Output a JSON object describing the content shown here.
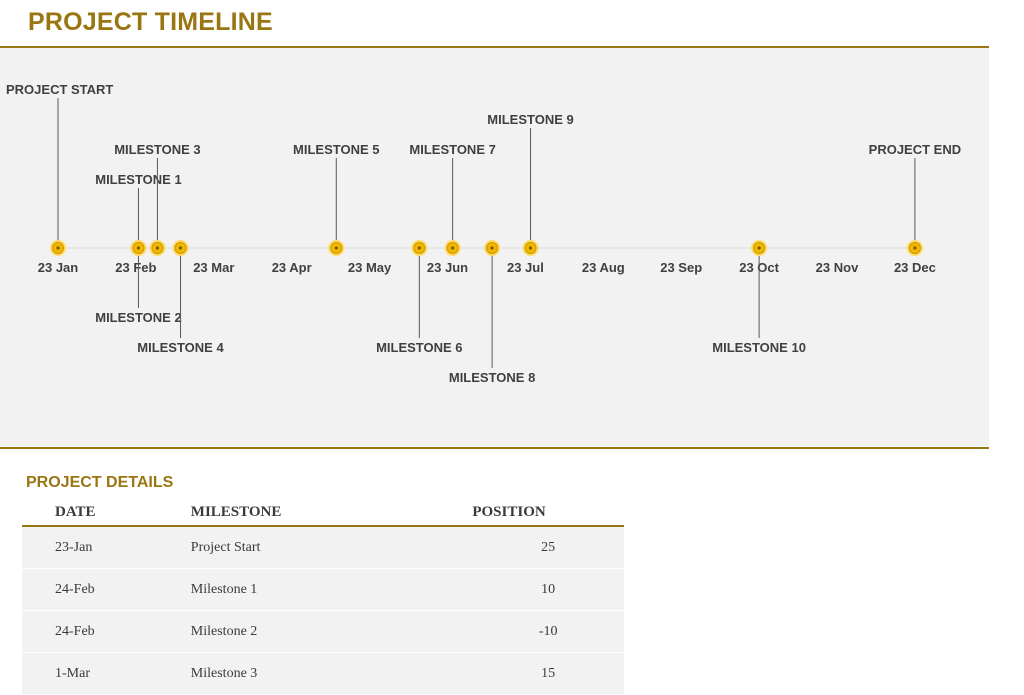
{
  "header": {
    "title": "PROJECT TIMELINE"
  },
  "colors": {
    "accent": "#9a7612",
    "marker_fill": "#f2b800",
    "marker_ring": "#ffd966",
    "panel": "#f2f2f2"
  },
  "chart_data": {
    "type": "scatter",
    "x_axis": {
      "tick_labels": [
        "23 Jan",
        "23 Feb",
        "23 Mar",
        "23 Apr",
        "23 May",
        "23 Jun",
        "23 Jul",
        "23 Aug",
        "23 Sep",
        "23 Oct",
        "23 Nov",
        "23 Dec"
      ]
    },
    "events": [
      {
        "label": "PROJECT START",
        "date": "23-Jan",
        "position": 25
      },
      {
        "label": "MILESTONE 1",
        "date": "24-Feb",
        "position": 10
      },
      {
        "label": "MILESTONE 2",
        "date": "24-Feb",
        "position": -10
      },
      {
        "label": "MILESTONE 3",
        "date": "1-Mar",
        "position": 15
      },
      {
        "label": "MILESTONE 4",
        "date": "10-Mar",
        "position": -15
      },
      {
        "label": "MILESTONE 5",
        "date": "10-May",
        "position": 15
      },
      {
        "label": "MILESTONE 6",
        "date": "12-Jun",
        "position": -15
      },
      {
        "label": "MILESTONE 7",
        "date": "25-Jun",
        "position": 15
      },
      {
        "label": "MILESTONE 8",
        "date": "10-Jul",
        "position": -20
      },
      {
        "label": "MILESTONE 9",
        "date": "25-Jul",
        "position": 20
      },
      {
        "label": "MILESTONE 10",
        "date": "23-Oct",
        "position": -15
      },
      {
        "label": "PROJECT END",
        "date": "23-Dec",
        "position": 15
      }
    ]
  },
  "details": {
    "heading": "PROJECT DETAILS",
    "columns": {
      "date": "DATE",
      "milestone": "MILESTONE",
      "position": "POSITION"
    },
    "rows": [
      {
        "date": "23-Jan",
        "milestone": "Project Start",
        "position": "25"
      },
      {
        "date": "24-Feb",
        "milestone": "Milestone 1",
        "position": "10"
      },
      {
        "date": "24-Feb",
        "milestone": "Milestone 2",
        "position": "-10"
      },
      {
        "date": "1-Mar",
        "milestone": "Milestone 3",
        "position": "15"
      }
    ]
  }
}
